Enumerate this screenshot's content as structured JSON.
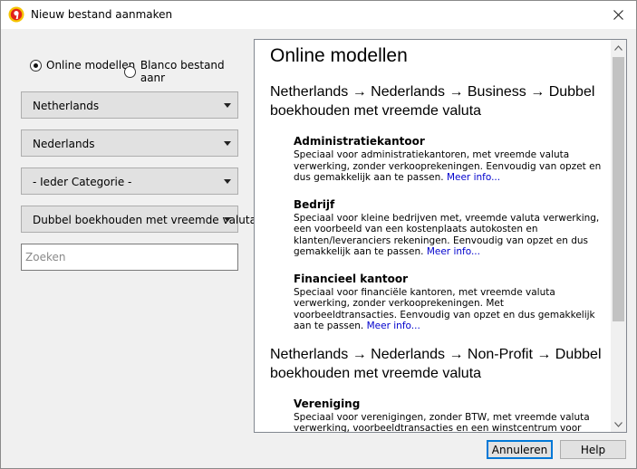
{
  "window": {
    "title": "Nieuw bestand aanmaken"
  },
  "left": {
    "radio_online": "Online modellen",
    "radio_blank": "Blanco bestand aanr",
    "combos": [
      "Netherlands",
      "Nederlands",
      "- Ieder Categorie -",
      "Dubbel boekhouden met vreemde valuta"
    ],
    "search_placeholder": "Zoeken"
  },
  "content": {
    "heading": "Online modellen",
    "groups": [
      {
        "path": "Netherlands → Nederlands → Business → Dubbel boekhouden met vreemde valuta",
        "items": [
          {
            "title": "Administratiekantoor",
            "desc": "Speciaal voor administratiekantoren, met vreemde valuta verwerking, zonder verkooprekeningen. Eenvoudig van opzet en dus gemakkelijk aan te passen.",
            "more": "Meer info..."
          },
          {
            "title": "Bedrijf",
            "desc": "Speciaal voor kleine bedrijven met, vreemde valuta verwerking, een voorbeeld van een kostenplaats autokosten en klanten/leveranciers rekeningen. Eenvoudig van opzet en dus gemakkelijk aan te passen.",
            "more": "Meer info..."
          },
          {
            "title": "Financieel kantoor",
            "desc": "Speciaal voor financiële kantoren, met vreemde valuta verwerking, zonder verkooprekeningen. Met voorbeeldtransacties. Eenvoudig van opzet en dus gemakkelijk aan te passen.",
            "more": "Meer info..."
          }
        ]
      },
      {
        "path": "Netherlands → Nederlands → Non-Profit → Dubbel boekhouden met vreemde valuta",
        "items": [
          {
            "title": "Vereniging",
            "desc": "Speciaal voor verenigingen, zonder BTW, met vreemde valuta verwerking, voorbeeldtransacties en een winstcentrum voor ledenadministratie. Eenvoudig van opzet en dus gemakkelijk aan te passen."
          }
        ]
      }
    ]
  },
  "buttons": {
    "cancel": "Annuleren",
    "help": "Help"
  },
  "colors": {
    "accent": "#0078d7",
    "link": "#0000cc"
  }
}
